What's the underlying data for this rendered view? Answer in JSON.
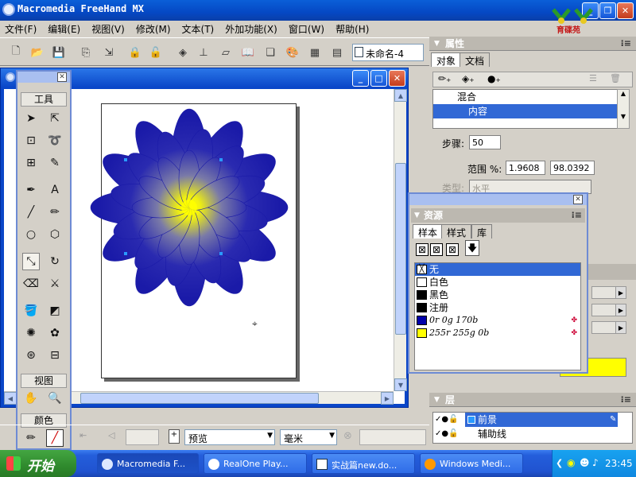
{
  "app": {
    "title": "Macromedia FreeHand MX",
    "brand_text": "育碟苑"
  },
  "menu": [
    "文件(F)",
    "编辑(E)",
    "视图(V)",
    "修改(M)",
    "文本(T)",
    "外加功能(X)",
    "窗口(W)",
    "帮助(H)"
  ],
  "toolbar": {
    "doc_select_value": "未命名-4"
  },
  "tools_panel": {
    "tools_label": "工具",
    "view_label": "视图",
    "color_label": "颜色"
  },
  "properties": {
    "title": "属性",
    "tabs": [
      "对象",
      "文档"
    ],
    "list": [
      {
        "label": "混合",
        "selected": false
      },
      {
        "label": "内容",
        "selected": true
      }
    ],
    "steps_label": "步骤:",
    "steps_value": "50",
    "range_label": "范围 %:",
    "range_from": "1.9608",
    "range_to": "98.0392",
    "type_label": "类型:",
    "type_value": "水平"
  },
  "swatches": {
    "title": "资源",
    "tabs": [
      "样本",
      "样式",
      "库"
    ],
    "items": [
      {
        "name": "无",
        "color": "none",
        "selected": true
      },
      {
        "name": "白色",
        "color": "#ffffff",
        "selected": false
      },
      {
        "name": "黑色",
        "color": "#000000",
        "selected": false
      },
      {
        "name": "注册",
        "color": "#000000",
        "selected": false
      },
      {
        "name": "0r 0g 170b",
        "color": "#0000aa",
        "selected": false,
        "italic": true
      },
      {
        "name": "255r 255g 0b",
        "color": "#ffff00",
        "selected": false,
        "italic": true
      }
    ]
  },
  "layers": {
    "title": "层",
    "items": [
      {
        "name": "前景",
        "selected": true
      },
      {
        "name": "辅助线",
        "selected": false
      }
    ]
  },
  "statusbar": {
    "view_mode": "预览",
    "units": "毫米"
  },
  "taskbar": {
    "start_label": "开始",
    "tasks": [
      {
        "label": "Macromedia F...",
        "active": true
      },
      {
        "label": "RealOne Play...",
        "active": false
      },
      {
        "label": "实战篇new.do...",
        "active": false
      },
      {
        "label": "Windows Medi...",
        "active": false
      }
    ],
    "clock": "23:45"
  },
  "colors": {
    "flower_outer": "#1a1aa8",
    "flower_center": "#ffff00",
    "selection": "#3168d5"
  }
}
